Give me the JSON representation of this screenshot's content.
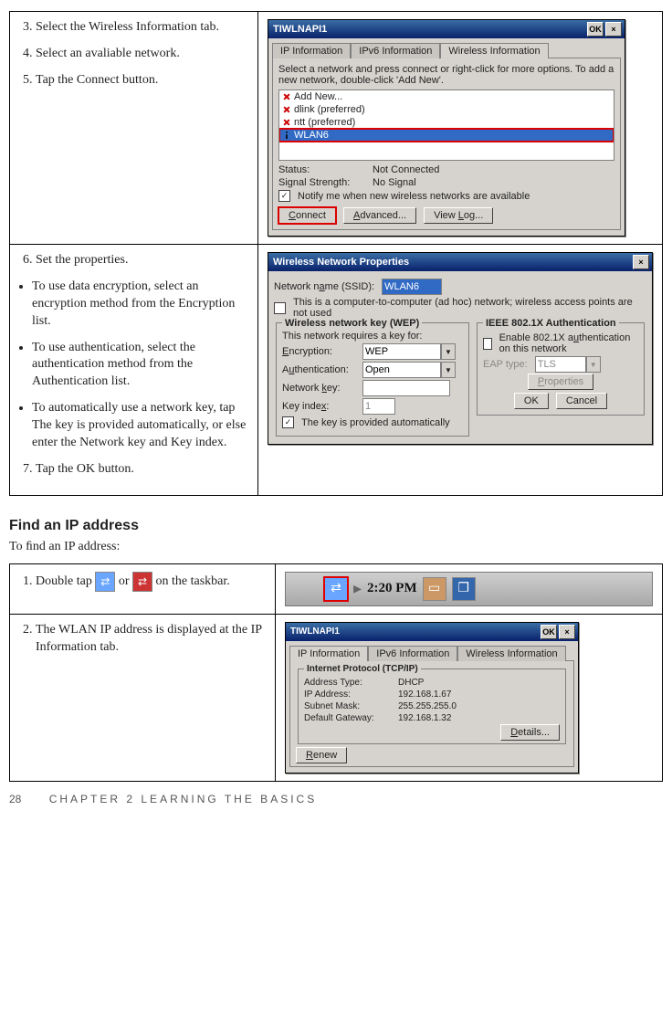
{
  "row1": {
    "steps": {
      "s3": "Select the Wireless Information tab.",
      "s4": "Select an avaliable network.",
      "s5": "Tap the Connect button."
    },
    "win": {
      "title": "TIWLNAPI1",
      "ok": "OK",
      "x": "×",
      "tabs": {
        "t1": "IP Information",
        "t2": "IPv6 Information",
        "t3": "Wireless Information"
      },
      "hint": "Select a network and press connect or right-click for more options.  To add a new network, double-click 'Add New'.",
      "items": {
        "i1": "Add New...",
        "i2": "dlink (preferred)",
        "i3": "ntt (preferred)",
        "i4": "WLAN6"
      },
      "status_l": "Status:",
      "status_v": "Not Connected",
      "sig_l": "Signal Strength:",
      "sig_v": "No Signal",
      "notify": "Notify me when new wireless networks are available",
      "btns": {
        "connect": "Connect",
        "adv": "Advanced...",
        "log": "View Log..."
      }
    }
  },
  "row2": {
    "steps": {
      "s6": "Set the properties.",
      "b1": "To use data encryption, select an encryption method from the Encryption list.",
      "b2": "To use authentication, select the authentication method from the Authentication list.",
      "b3": "To automatically use a network key, tap The key is provided automatically, or else enter the Network key and Key index.",
      "s7": "Tap the OK button."
    },
    "win": {
      "title": "Wireless Network Properties",
      "x": "×",
      "ssid_l": "Network name (SSID):",
      "ssid_v": "WLAN6",
      "adhoc": "This is a computer-to-computer (ad hoc) network; wireless access points are not used",
      "wep_legend": "Wireless network key (WEP)",
      "req": "This network requires a key for:",
      "enc_l": "Encryption:",
      "enc_v": "WEP",
      "auth_l": "Authentication:",
      "auth_v": "Open",
      "key_l": "Network key:",
      "idx_l": "Key index:",
      "idx_v": "1",
      "auto": "The key is provided automatically",
      "ieee_legend": "IEEE 802.1X Authentication",
      "enable": "Enable 802.1X authentication on this network",
      "eap_l": "EAP type:",
      "eap_v": "TLS",
      "prop": "Properties",
      "ok": "OK",
      "cancel": "Cancel"
    }
  },
  "section": {
    "title": "Find an IP address",
    "lead": "To ﬁnd an IP address:"
  },
  "row3": {
    "step": {
      "pre": "Double tap ",
      "mid": " or ",
      "post": " on the taskbar."
    },
    "taskbar": {
      "time": "2:20 PM"
    }
  },
  "row4": {
    "step": "The WLAN IP address is displayed at the IP Information tab.",
    "win": {
      "title": "TIWLNAPI1",
      "ok": "OK",
      "x": "×",
      "tabs": {
        "t1": "IP Information",
        "t2": "IPv6 Information",
        "t3": "Wireless Information"
      },
      "legend": "Internet Protocol (TCP/IP)",
      "at_l": "Address Type:",
      "at_v": "DHCP",
      "ip_l": "IP Address:",
      "ip_v": "192.168.1.67",
      "sm_l": "Subnet Mask:",
      "sm_v": "255.255.255.0",
      "gw_l": "Default Gateway:",
      "gw_v": "192.168.1.32",
      "details": "Details...",
      "renew": "Renew"
    }
  },
  "footer": {
    "page": "28",
    "chapter": "CHAPTER 2 LEARNING THE BASICS"
  }
}
